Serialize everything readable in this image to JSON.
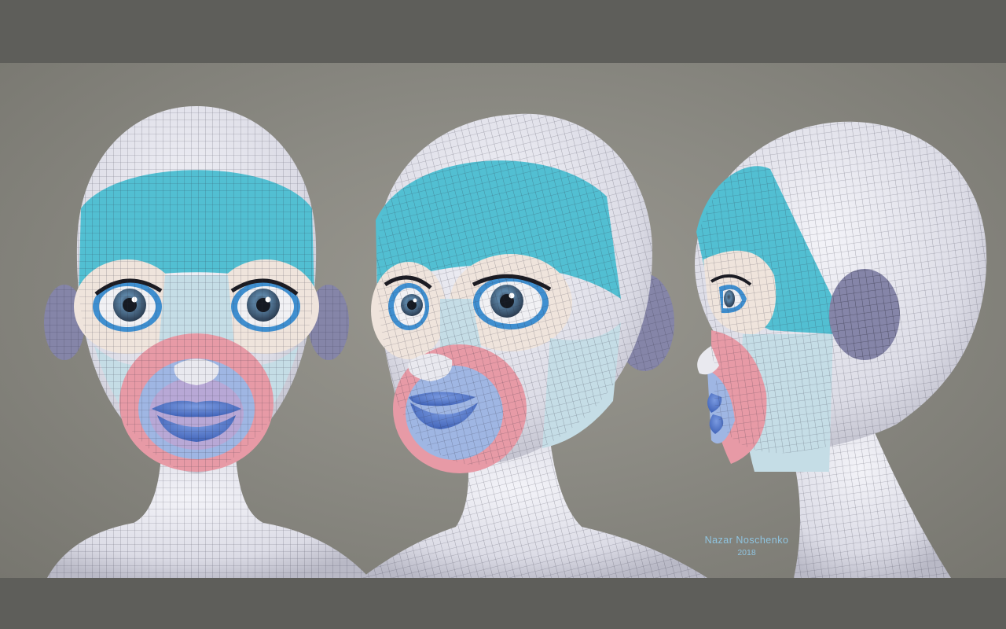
{
  "credit": {
    "author": "Nazar Noschenko",
    "year": "2018"
  },
  "views": [
    {
      "id": "front"
    },
    {
      "id": "three-quarter"
    },
    {
      "id": "profile"
    }
  ],
  "colors": {
    "frame": "#5e5e5a",
    "background": "#8b8a83",
    "skin": "#e8e8ee",
    "forehead": "#52bfd2",
    "eye_ring": "#efe4dc",
    "cheek": "#c5dde6",
    "mouth_ring": "#e79aa6",
    "lips": "#4f74c9",
    "ear": "#8585a8",
    "wire": "#2c2c3c",
    "credit_text": "#8fc4e0"
  }
}
